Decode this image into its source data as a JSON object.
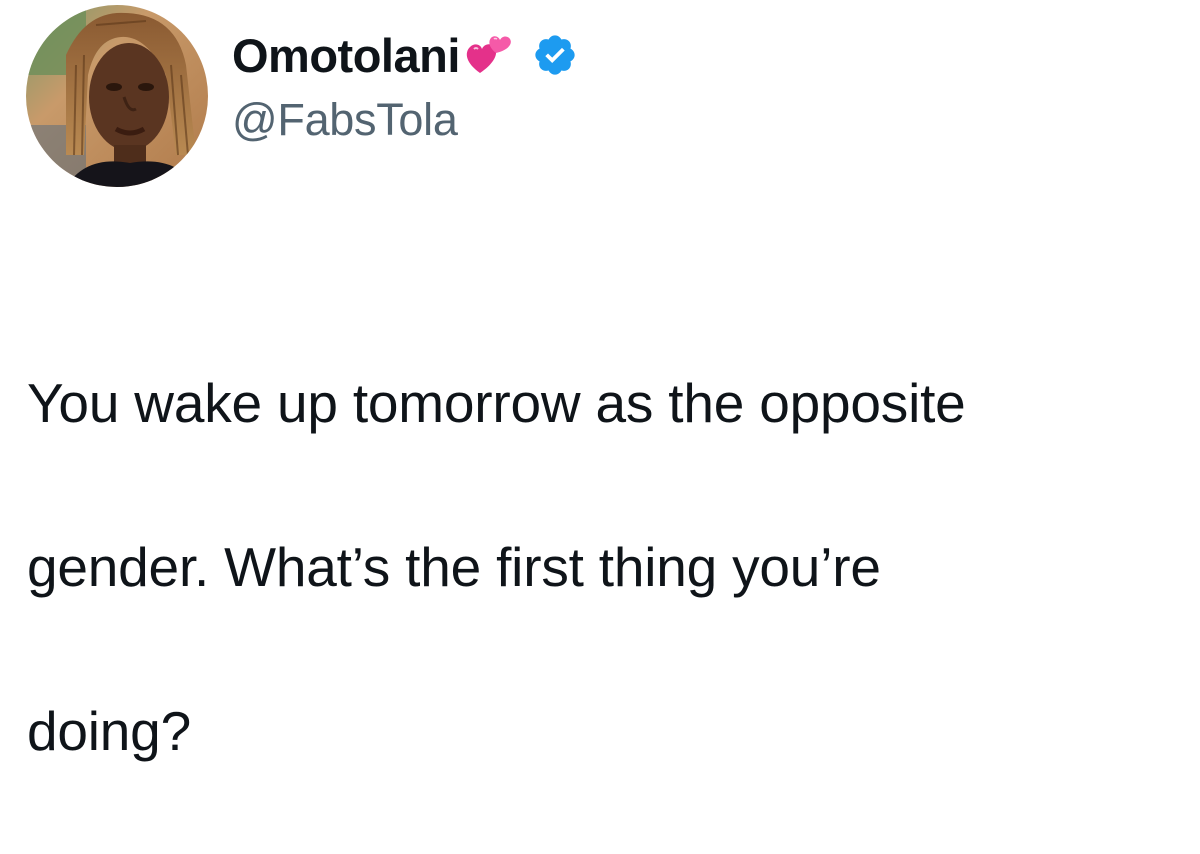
{
  "tweet": {
    "author": {
      "display_name": "Omotolani",
      "handle": "@FabsTola",
      "verified": true,
      "name_emoji": "revolving-hearts-icon",
      "avatar": "profile-photo"
    },
    "text_lines": [
      "You wake up tomorrow as the opposite",
      "gender. What’s the first thing you’re",
      "doing?"
    ]
  },
  "colors": {
    "text_primary": "#0f1419",
    "text_secondary": "#536471",
    "verified_blue": "#1d9bf0",
    "heart_pink": "#e4318a",
    "background": "#ffffff"
  }
}
